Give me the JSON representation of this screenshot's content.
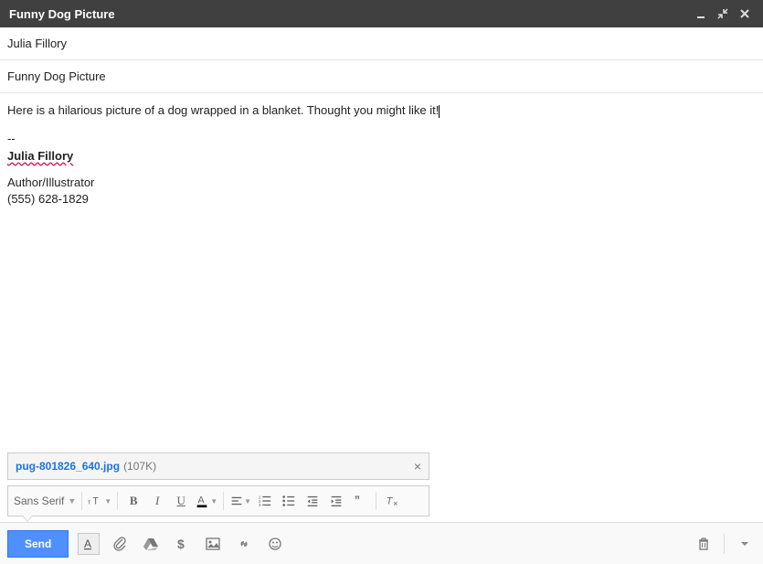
{
  "window": {
    "title": "Funny Dog Picture"
  },
  "fields": {
    "to": "Julia Fillory",
    "subject": "Funny Dog Picture"
  },
  "body": {
    "text": "Here is a hilarious picture of a dog wrapped in a blanket. Thought you might like it!",
    "sig_sep": "--",
    "sig_name": "Julia Fillory",
    "sig_line1": "Author/Illustrator",
    "sig_line2": "(555) 628-1829"
  },
  "attachment": {
    "name": "pug-801826_640.jpg",
    "size": "(107K)"
  },
  "format": {
    "font": "Sans Serif"
  },
  "actions": {
    "send": "Send"
  }
}
